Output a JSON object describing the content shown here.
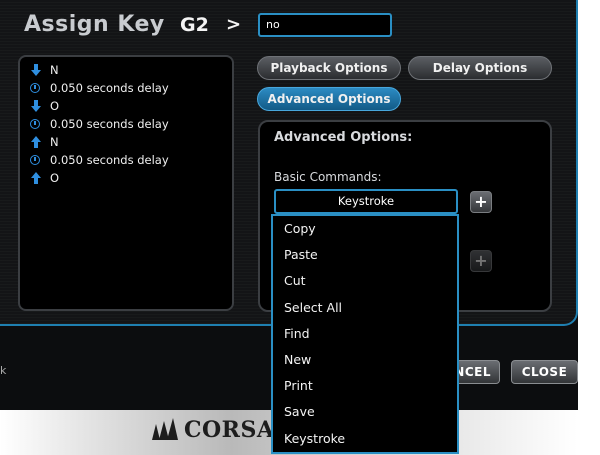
{
  "header": {
    "title": "Assign Key",
    "key_name": "G2",
    "chevron": ">",
    "name_value": "no"
  },
  "macro": {
    "events": [
      {
        "type": "key-down",
        "icon": "arrow-down-icon",
        "text": "N"
      },
      {
        "type": "delay",
        "icon": "clock-icon",
        "text": "0.050 seconds delay"
      },
      {
        "type": "key-down",
        "icon": "arrow-down-icon",
        "text": "O"
      },
      {
        "type": "delay",
        "icon": "clock-icon",
        "text": "0.050 seconds delay"
      },
      {
        "type": "key-up",
        "icon": "arrow-up-icon",
        "text": "N"
      },
      {
        "type": "delay",
        "icon": "clock-icon",
        "text": "0.050 seconds delay"
      },
      {
        "type": "key-up",
        "icon": "arrow-up-icon",
        "text": "O"
      }
    ]
  },
  "options": {
    "playback_label": "Playback Options",
    "delay_label": "Delay Options",
    "advanced_label": "Advanced Options"
  },
  "advanced": {
    "title": "Advanced Options:",
    "basic_commands_label": "Basic Commands:",
    "selected_command": "Keystroke",
    "add_glyph": "+",
    "dropdown_options": [
      "Copy",
      "Paste",
      "Cut",
      "Select All",
      "Find",
      "New",
      "Print",
      "Save",
      "Keystroke"
    ]
  },
  "footer_buttons": {
    "cancel_partial": "NCEL",
    "close": "CLOSE",
    "left_glyph": "k"
  },
  "brand": {
    "name": "CORSAIR"
  },
  "colors": {
    "accent": "#2a8fc4",
    "background": "#131416",
    "panel": "#000000"
  }
}
